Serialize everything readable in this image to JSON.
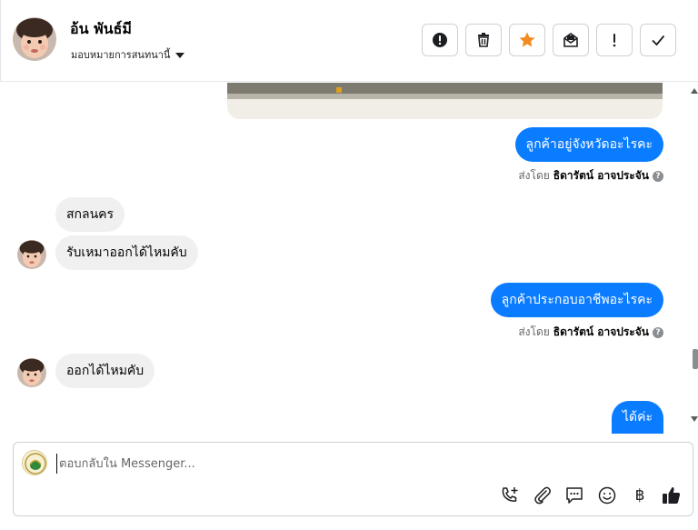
{
  "header": {
    "contact_name": "อ้น พันธ์มี",
    "assign_label": "มอบหมายการสนทนานี้"
  },
  "messages": [
    {
      "kind": "outgoing",
      "text": "ลูกค้าอยู่จังหวัดอะไรคะ"
    },
    {
      "kind": "sent_by",
      "prefix": "ส่งโดย",
      "name": "ธิดารัตน์ อาจประจัน"
    },
    {
      "kind": "incoming",
      "text": "สกลนคร"
    },
    {
      "kind": "incoming",
      "text": "รับเหมาออกได้ไหมคับ"
    },
    {
      "kind": "outgoing",
      "text": "ลูกค้าประกอบอาชีพอะไรคะ"
    },
    {
      "kind": "sent_by",
      "prefix": "ส่งโดย",
      "name": "ธิดารัตน์ อาจประจัน"
    },
    {
      "kind": "incoming",
      "text": "ออกได้ไหมคับ"
    },
    {
      "kind": "outgoing",
      "text": "ได้ค่ะ"
    }
  ],
  "composer": {
    "placeholder": "ตอบกลับใน Messenger...",
    "currency_symbol": "฿"
  },
  "colors": {
    "outgoing_bubble": "#0a7cff",
    "incoming_bubble": "#f0f0f0",
    "star": "#f28c22"
  }
}
